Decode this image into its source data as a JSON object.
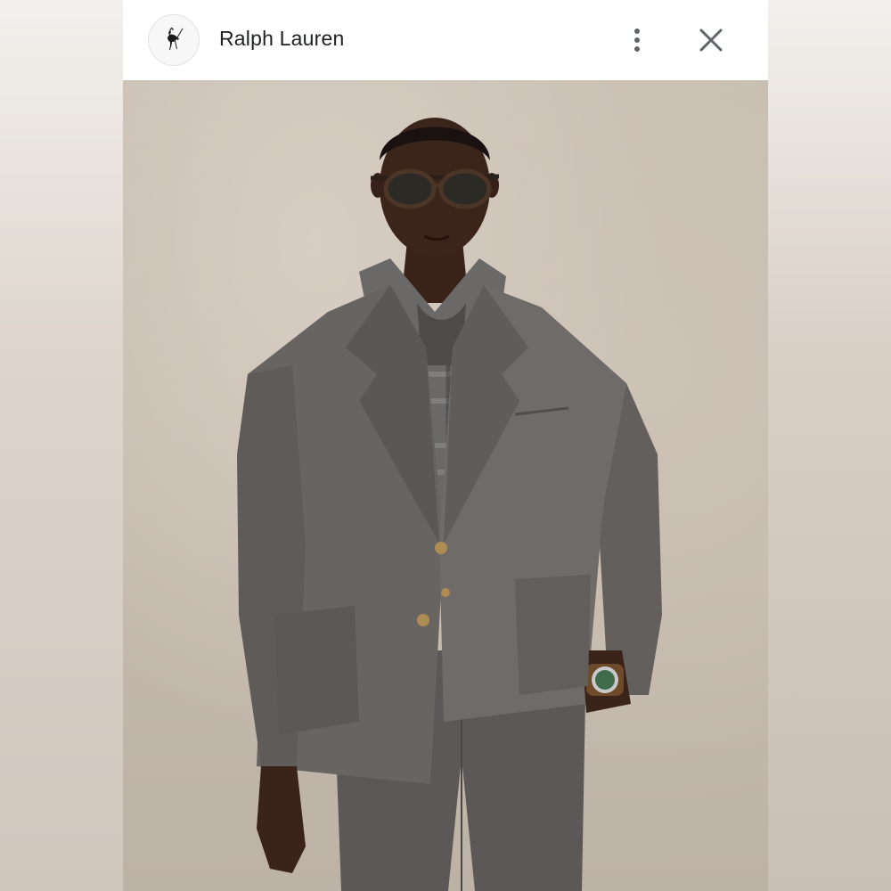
{
  "header": {
    "brand_name": "Ralph Lauren",
    "logo_icon": "polo-player-icon",
    "more_icon": "more-vertical-icon",
    "close_icon": "close-icon"
  },
  "colors": {
    "header_bg": "#ffffff",
    "text": "#202124",
    "icon": "#5f6368"
  }
}
